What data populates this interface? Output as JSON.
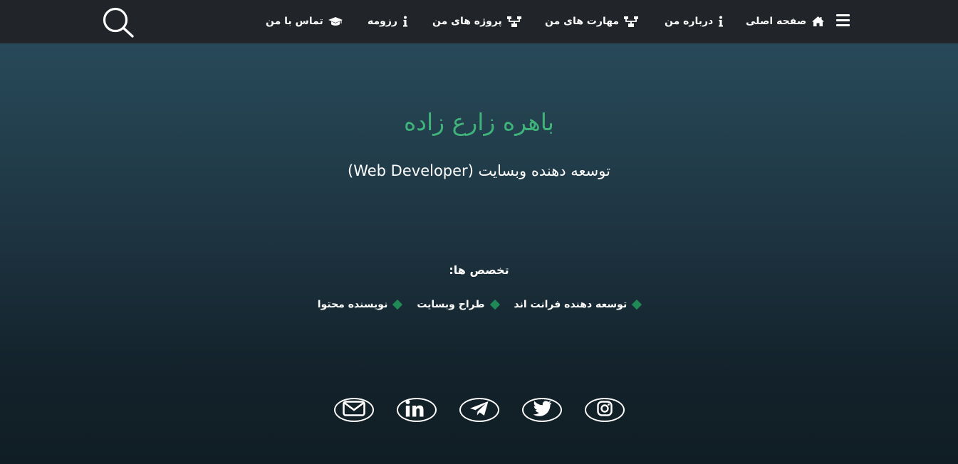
{
  "nav": {
    "items": [
      {
        "label": "صفحه اصلی",
        "icon": "home-icon"
      },
      {
        "label": "درباره من",
        "icon": "info-icon"
      },
      {
        "label": "مهارت های من",
        "icon": "sitemap-icon"
      },
      {
        "label": "پروژه های من",
        "icon": "sitemap-icon"
      },
      {
        "label": "رزومه",
        "icon": "info-icon"
      },
      {
        "label": "تماس با من",
        "icon": "graduation-cap-icon"
      }
    ],
    "menu_icon": "hamburger-menu-icon",
    "search_icon": "search-icon"
  },
  "hero": {
    "name": "باهره زارع زاده",
    "role": "توسعه دهنده وبسایت (Web Developer)"
  },
  "specialties": {
    "heading": "تخصص ها:",
    "items": [
      "توسعه دهنده فرانت اند",
      "طراح وبسایت",
      "نویسنده محتوا"
    ]
  },
  "social": [
    {
      "icon": "instagram-icon"
    },
    {
      "icon": "twitter-icon"
    },
    {
      "icon": "telegram-icon"
    },
    {
      "icon": "linkedin-icon"
    },
    {
      "icon": "email-icon"
    }
  ],
  "colors": {
    "navbar": "#212429",
    "accent": "#3fb37a",
    "bullet": "#1f8a55",
    "bg_top": "#2a4e5f",
    "bg_bottom": "#101d24"
  }
}
